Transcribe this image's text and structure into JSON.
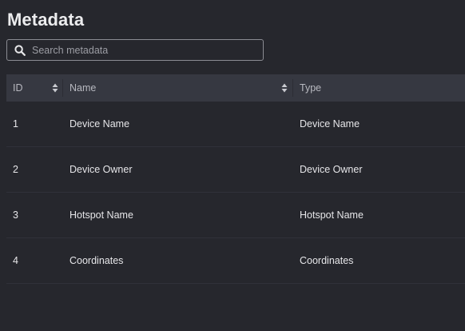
{
  "header": {
    "title": "Metadata"
  },
  "search": {
    "placeholder": "Search metadata",
    "value": ""
  },
  "table": {
    "columns": [
      {
        "label": "ID",
        "sortable": true
      },
      {
        "label": "Name",
        "sortable": true
      },
      {
        "label": "Type",
        "sortable": false
      }
    ],
    "rows": [
      {
        "id": "1",
        "name": "Device Name",
        "type": "Device Name"
      },
      {
        "id": "2",
        "name": "Device Owner",
        "type": "Device Owner"
      },
      {
        "id": "3",
        "name": "Hotspot Name",
        "type": "Hotspot Name"
      },
      {
        "id": "4",
        "name": "Coordinates",
        "type": "Coordinates"
      }
    ]
  },
  "icons": {
    "search": "search-icon",
    "sort": "sort-icon"
  },
  "colors": {
    "background": "#26272d",
    "header_row": "#363841",
    "text": "#e8e8ea",
    "muted_text": "#b7b8bf"
  }
}
